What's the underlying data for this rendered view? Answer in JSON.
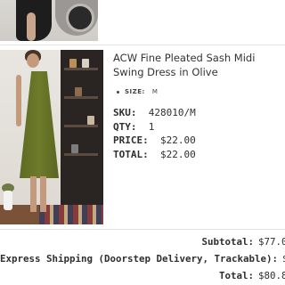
{
  "item": {
    "title": "ACW Fine Pleated Sash Midi Swing Dress in Olive",
    "size_label": "SIZE:",
    "size_value": "M",
    "sku_label": "SKU:",
    "sku_value": "428010/M",
    "qty_label": "QTY:",
    "qty_value": "1",
    "price_label": "PRICE:",
    "price_value": "$22.00",
    "total_label": "TOTAL:",
    "total_value": "$22.00"
  },
  "summary": {
    "subtotal_label": "Subtotal:",
    "subtotal_value": "$77.0",
    "shipping_label": "Express Shipping (Doorstep Delivery, Trackable):",
    "shipping_value": "$3.8",
    "total_label": "Total:",
    "total_value": "$80.8"
  },
  "colors": {
    "dress": "#6e7b2b",
    "text": "#2f2f2f"
  }
}
